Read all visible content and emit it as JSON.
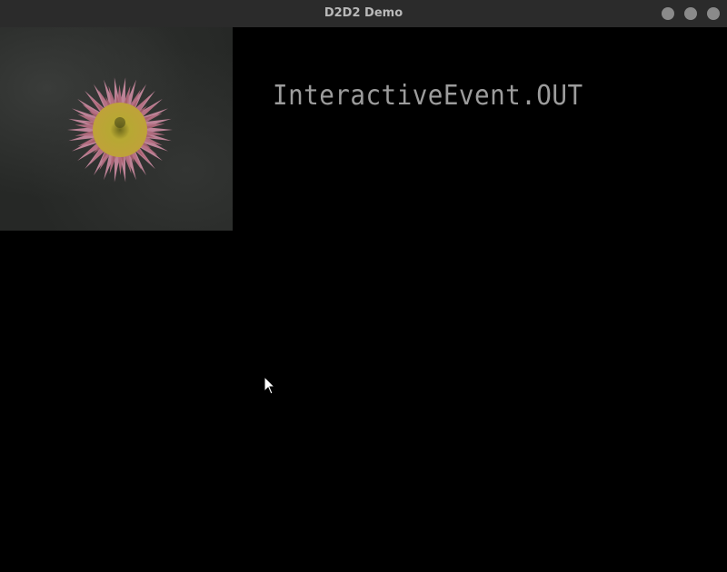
{
  "window": {
    "title": "D2D2 Demo",
    "controls": [
      "minimize-icon",
      "maximize-icon",
      "close-icon"
    ],
    "control_color": "#8a8a8a",
    "titlebar_color": "#2b2b2b"
  },
  "canvas": {
    "background": "#000000",
    "event_label": "InteractiveEvent.OUT",
    "event_label_color": "#9c9c9c",
    "sprite": {
      "subject": "pink-flower",
      "state": "dimmed"
    },
    "pointer": "arrow-cursor-icon"
  }
}
